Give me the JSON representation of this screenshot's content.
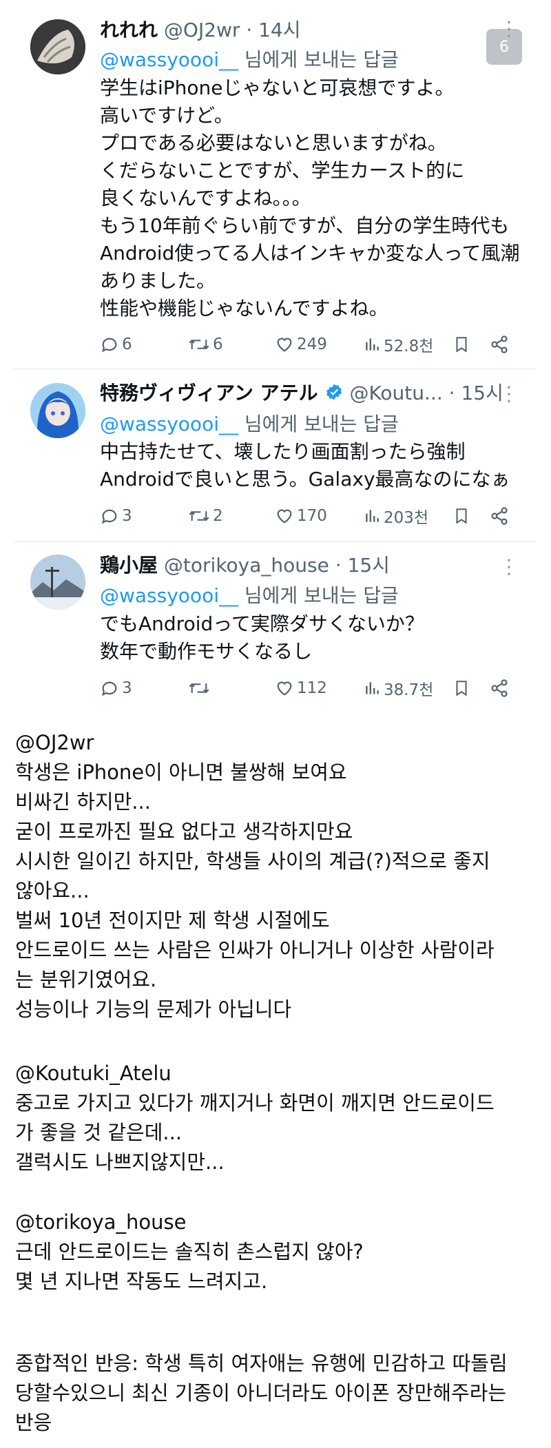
{
  "badge": "6",
  "reply_suffix": "님에게 보내는 답글",
  "tweets": [
    {
      "name": "れれれ",
      "handle": "@OJ2wr",
      "time": "· 14시",
      "reply_to": "@wassyoooi__",
      "lines": [
        "学生はiPhoneじゃないと可哀想ですよ。",
        "高いですけど。",
        "プロである必要はないと思いますがね。",
        "くだらないことですが、学生カースト的に",
        "良くないんですよね。。。",
        "もう10年前ぐらい前ですが、自分の学生時代も",
        "Android使ってる人はインキャか変な人って風潮",
        "ありました。",
        "性能や機能じゃないんですよね。"
      ],
      "replies": "6",
      "retweets": "6",
      "likes": "249",
      "views": "52.8천"
    },
    {
      "name": "特務ヴィヴィアン アテル",
      "handle": "@Koutu...",
      "time": "· 15시",
      "reply_to": "@wassyoooi__",
      "lines": [
        "中古持たせて、壊したり画面割ったら強制",
        "Androidで良いと思う。Galaxy最高なのになぁ"
      ],
      "replies": "3",
      "retweets": "2",
      "likes": "170",
      "views": "203천"
    },
    {
      "name": "鶏小屋",
      "handle": "@torikoya_house",
      "time": "· 15시",
      "reply_to": "@wassyoooi__",
      "lines": [
        "でもAndroidって実際ダサくないか？",
        "数年で動作モサくなるし"
      ],
      "replies": "3",
      "retweets": "",
      "likes": "112",
      "views": "38.7천"
    }
  ],
  "translation": {
    "block1": [
      "@OJ2wr",
      "학생은 iPhone이 아니면 불쌍해 보여요",
      "비싸긴 하지만...",
      "굳이 프로까진 필요 없다고 생각하지만요",
      "시시한 일이긴 하지만, 학생들 사이의 계급(?)적으로 좋지",
      "않아요...",
      "벌써 10년 전이지만 제 학생 시절에도",
      "안드로이드 쓰는 사람은 인싸가 아니거나 이상한 사람이라",
      "는 분위기였어요.",
      "성능이나 기능의 문제가 아닙니다"
    ],
    "block2": [
      "@Koutuki_Atelu",
      "중고로 가지고 있다가 깨지거나 화면이 깨지면 안드로이드",
      "가 좋을 것 같은데...",
      "갤럭시도 나쁘지않지만..."
    ],
    "block3": [
      "@torikoya_house",
      "근데 안드로이드는 솔직히 촌스럽지 않아?",
      "몇 년 지나면 작동도 느려지고."
    ],
    "block4": [
      "종합적인 반응: 학생 특히 여자애는 유행에 민감하고 따돌림",
      "당할수있으니 최신 기종이 아니더라도 아이폰 장만해주라는",
      "반응"
    ]
  },
  "colors": {
    "accent": "#1d9bf0",
    "secondary": "#536471",
    "verified": "#1d9bf0"
  }
}
